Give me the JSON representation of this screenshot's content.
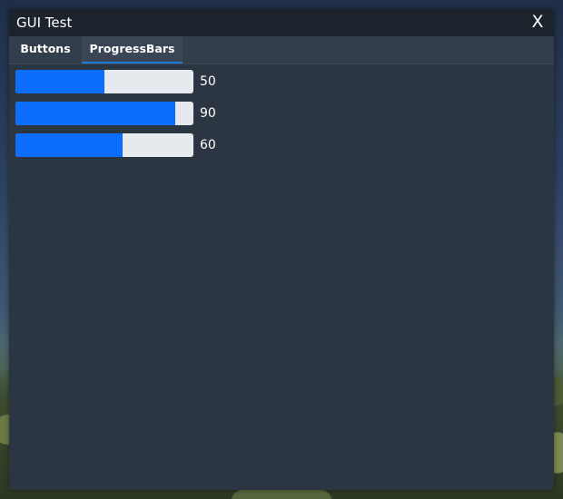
{
  "window": {
    "title": "GUI Test",
    "close_label": "X"
  },
  "tabs": [
    {
      "label": "Buttons",
      "active": false
    },
    {
      "label": "ProgressBars",
      "active": true
    }
  ],
  "progress_bars": [
    {
      "value": 50,
      "label": "50"
    },
    {
      "value": 90,
      "label": "90"
    },
    {
      "value": 60,
      "label": "60"
    }
  ],
  "colors": {
    "accent": "#0d6efd",
    "track": "#e6e9ee",
    "window_bg": "#2b3542",
    "titlebar_bg": "#1c232c"
  }
}
